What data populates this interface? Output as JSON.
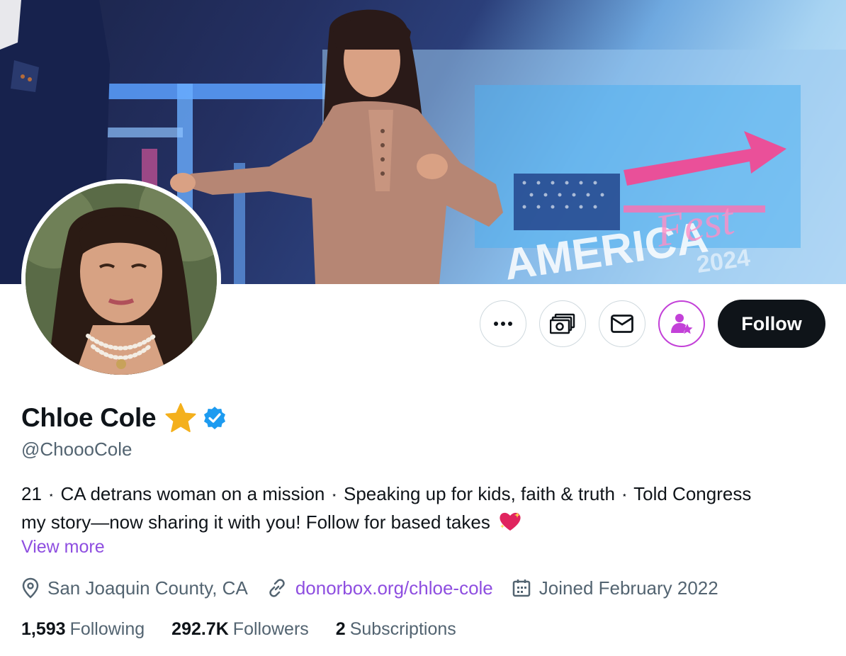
{
  "profile": {
    "display_name": "Chloe Cole",
    "handle": "@ChoooCole",
    "bio_line1_parts": [
      "21",
      "CA detrans woman on a mission",
      "Speaking up for kids, faith & truth",
      "Told Congress"
    ],
    "bio_separator": "⋆",
    "bio_line2": "my story—now sharing it with you! Follow for based takes",
    "view_more": "View more",
    "location": "San Joaquin County, CA",
    "website": "donorbox.org/chloe-cole",
    "joined": "Joined February 2022"
  },
  "stats": {
    "following_count": "1,593",
    "following_label": "Following",
    "followers_count": "292.7K",
    "followers_label": "Followers",
    "subscriptions_count": "2",
    "subscriptions_label": "Subscriptions"
  },
  "actions": {
    "follow_label": "Follow",
    "more_icon": "more-horizontal-icon",
    "tip_icon": "money-icon",
    "message_icon": "envelope-icon",
    "subscribe_icon": "subscribe-user-star-icon"
  },
  "banner": {
    "sign_text_1": "AMERICA",
    "sign_text_2": "Fest",
    "sign_text_3": "2024"
  },
  "colors": {
    "text_primary": "#0f1419",
    "text_secondary": "#536471",
    "link_purple": "#8e4ee0",
    "subscribe_magenta": "#c341d8",
    "verified_blue": "#1d9bf0",
    "star_gold": "#f4b01c"
  }
}
